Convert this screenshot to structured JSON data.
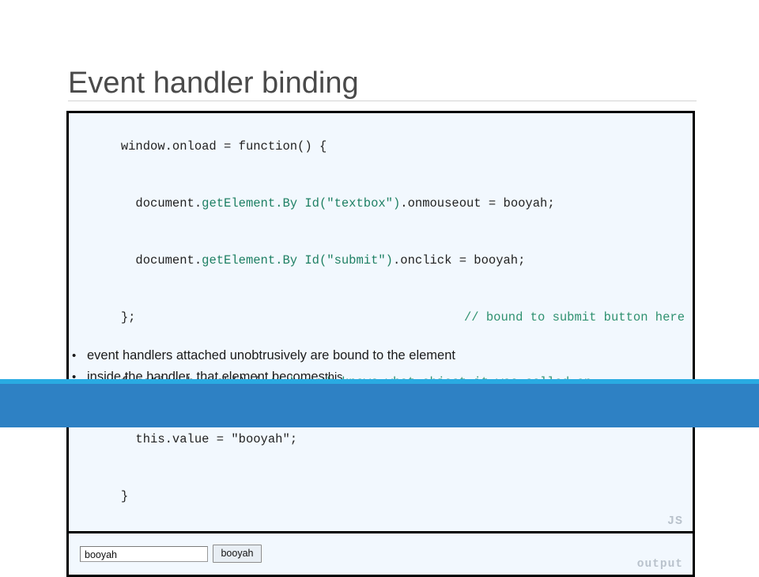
{
  "slide": {
    "title": "Event handler binding"
  },
  "code": {
    "language_tag": "JS",
    "lines": [
      {
        "id": "line1",
        "segments": [
          {
            "text": "window.onload = function() {",
            "style": "plain"
          }
        ]
      },
      {
        "id": "line2",
        "segments": [
          {
            "text": "   document.",
            "style": "plain"
          },
          {
            "text": "getElement.By Id(\"textbox\")",
            "style": "teal"
          },
          {
            "text": ".onmouseout = booyah;",
            "style": "plain"
          }
        ]
      },
      {
        "id": "line3",
        "segments": [
          {
            "text": "   document.",
            "style": "plain"
          },
          {
            "text": "getElement.By Id(\"submit\")",
            "style": "teal"
          },
          {
            "text": ".onclick = booyah;",
            "style": "plain"
          }
        ]
      },
      {
        "id": "line4",
        "left": "};",
        "right": "// bound to submit button here"
      },
      {
        "id": "line5",
        "segments": [
          {
            "text": "function booyah() { ",
            "style": "plain"
          },
          {
            "text": "// booyah knows what object it was called on",
            "style": "comment"
          }
        ]
      },
      {
        "id": "line6",
        "segments": [
          {
            "text": "   this.value = \"booyah\";",
            "style": "plain"
          }
        ]
      },
      {
        "id": "line7",
        "segments": [
          {
            "text": "}",
            "style": "plain"
          }
        ]
      }
    ],
    "line1": "window.onload = function() {",
    "line2_a": "  document.",
    "line2_b": "getElement.By Id(\"textbox\")",
    "line2_c": ".onmouseout = booyah;",
    "line3_a": "  document.",
    "line3_b": "getElement.By Id(\"submit\")",
    "line3_c": ".onclick = booyah;",
    "line4_left": "};",
    "line4_comment": "// bound to submit button here",
    "line5_a": "function booyah() { ",
    "line5_comment": "// booyah knows what object it was called on",
    "line6": "  this.value = \"booyah\";",
    "line7": "}"
  },
  "output": {
    "tag": "output",
    "textbox_value": "booyah",
    "textbox_placeholder": "",
    "button_label": "booyah"
  },
  "bullets": [
    {
      "marker": "•",
      "text": "event handlers attached unobtrusively are bound to the element",
      "keyword": ""
    },
    {
      "marker": "•",
      "text": "inside the handler, that element becomes ",
      "keyword": "this"
    }
  ],
  "colors": {
    "accent_light": "#29abe2",
    "accent_dark": "#2e81c4",
    "code_background": "#f2f8fe",
    "code_border": "#000000",
    "teal_token": "#1d7f63",
    "comment": "#2f9170",
    "tag_gray": "#b9c2cc",
    "title_gray": "#4a4a4a"
  }
}
